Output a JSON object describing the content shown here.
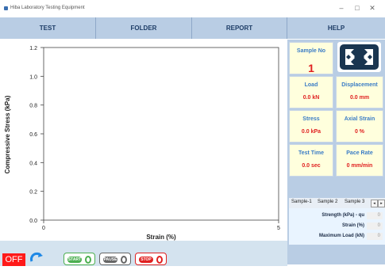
{
  "window": {
    "title": "Hiba Laboratory Testing Equipment",
    "minimize": "–",
    "maximize": "□",
    "close": "✕"
  },
  "menu": [
    "TEST",
    "FOLDER",
    "REPORT",
    "HELP"
  ],
  "chart_data": {
    "type": "line",
    "xlabel": "Strain (%)",
    "ylabel": "Compressive Stress (kPa)",
    "xlim": [
      0,
      5
    ],
    "ylim": [
      0,
      1.2
    ],
    "x_ticks": [
      "0",
      "5"
    ],
    "y_ticks": [
      "0.0",
      "0.2",
      "0.4",
      "0.6",
      "0.8",
      "1.0",
      "1.2"
    ],
    "series": []
  },
  "readouts": {
    "sample_no": {
      "label": "Sample No",
      "value": "1"
    },
    "load": {
      "label": "Load",
      "value": "0.0 kN"
    },
    "displacement": {
      "label": "Displacement",
      "value": "0.0 mm"
    },
    "stress": {
      "label": "Stress",
      "value": "0.0 kPa"
    },
    "axial_strain": {
      "label": "Axial Strain",
      "value": "0 %"
    },
    "test_time": {
      "label": "Test Time",
      "value": "0.0 sec"
    },
    "pace_rate": {
      "label": "Pace Rate",
      "value": "0 mm/min"
    }
  },
  "sample_tabs": [
    "Sample-1",
    "Sample 2",
    "Sample 3"
  ],
  "tab_arrows": {
    "left": "◂",
    "right": "▸"
  },
  "results": [
    {
      "label": "Strength (kPa) - qu",
      "value": "0"
    },
    {
      "label": "Strain (%)",
      "value": "0"
    },
    {
      "label": "Maximum Load (kN)",
      "value": "0"
    }
  ],
  "controls": {
    "off": "OFF",
    "start": "START",
    "pause": "PAUSE",
    "stop": "STOP"
  },
  "colors": {
    "menu_bg": "#b9cde4",
    "readout_bg": "#ffffdd",
    "readout_label": "#3a7cc6",
    "readout_value": "#e02020",
    "start": "#4caf50",
    "pause": "#666666",
    "stop": "#e02020"
  }
}
